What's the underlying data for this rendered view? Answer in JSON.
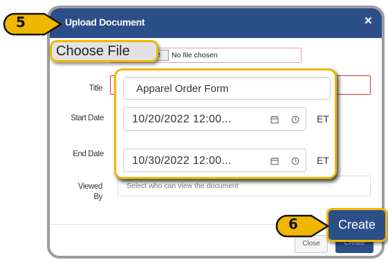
{
  "dialog": {
    "title": "Upload Document",
    "close_glyph": "×",
    "file": {
      "button_label": "Choose File",
      "status": "No file chosen"
    },
    "labels": {
      "title": "Title",
      "start_date": "Start Date",
      "end_date": "End Date",
      "viewed_by_1": "Viewed",
      "viewed_by_2": "By"
    },
    "title_value": "Apparel Order Form",
    "start_date": {
      "value": "10/20/2022 12:00...",
      "timezone": "ET"
    },
    "end_date": {
      "value": "10/30/2022 12:00...",
      "timezone": "ET"
    },
    "viewed_by_placeholder": "Select who can view the document",
    "buttons": {
      "close": "Close",
      "create": "Create"
    }
  },
  "callouts": {
    "step_5": "5",
    "step_6": "6",
    "choose_file_label": "Choose File",
    "create_label": "Create"
  },
  "icons": [
    "close-icon",
    "calendar-icon",
    "clock-icon"
  ],
  "colors": {
    "header": "#2c4f8a",
    "callout_border": "#f1b600",
    "error_border": "#d7303a",
    "frame": "#9a9ca1"
  }
}
